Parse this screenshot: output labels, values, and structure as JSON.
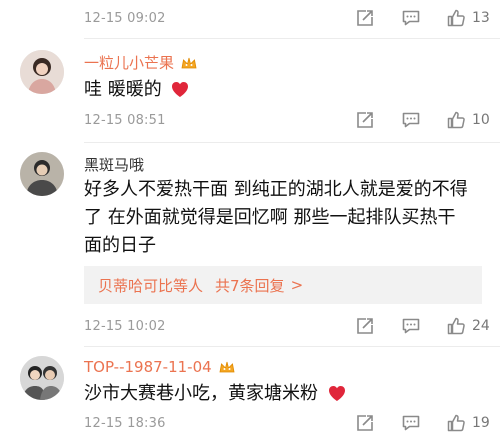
{
  "comments": [
    {
      "timestamp": "12-15 09:02",
      "likes": "13"
    },
    {
      "username": "一粒儿小芒果",
      "text": "哇 暖暖的",
      "timestamp": "12-15 08:51",
      "likes": "10"
    },
    {
      "username": "黑斑马哦",
      "text_lines": [
        "好多人不爱热干面   到纯正的湖北人就是爱的不得",
        "了   在外面就觉得是回忆啊   那些一起排队买热干",
        "面的日子"
      ],
      "reply_summary": {
        "users": "贝蒂哈可比等人",
        "count_text": "共7条回复",
        "chevron": ">"
      },
      "timestamp": "12-15 10:02",
      "likes": "24"
    },
    {
      "username": "TOP--1987-11-04",
      "text": "沙市大赛巷小吃，黄家塘米粉",
      "timestamp": "12-15 18:36",
      "likes": "19"
    }
  ],
  "icons": {
    "share": "share-icon",
    "comment": "comment-icon",
    "like": "thumbs-up-icon",
    "vip": "vip-crown-icon",
    "heart": "heart-emoji-icon"
  },
  "colors": {
    "username": "#eb7350",
    "timestamp": "#9a9a9a",
    "heart": "#e0263a",
    "reply_bg": "#f2f2f2"
  }
}
